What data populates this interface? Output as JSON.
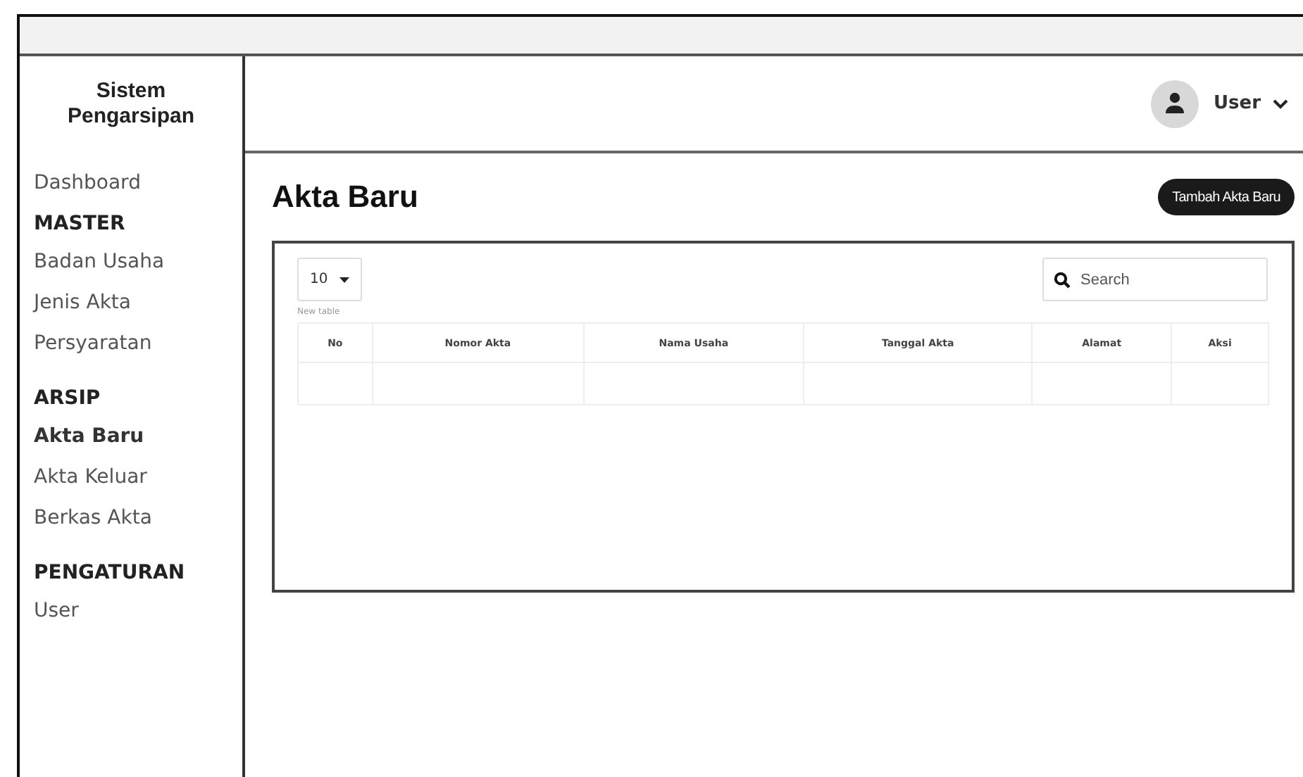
{
  "sidebar": {
    "brand": "Sistem Pengarsipan",
    "items": [
      {
        "kind": "link",
        "label": "Dashboard",
        "selected": false
      },
      {
        "kind": "heading",
        "label": "MASTER"
      },
      {
        "kind": "link",
        "label": "Badan Usaha",
        "selected": false
      },
      {
        "kind": "link",
        "label": "Jenis Akta",
        "selected": false
      },
      {
        "kind": "link",
        "label": "Persyaratan",
        "selected": false
      },
      {
        "kind": "heading",
        "label": "ARSIP"
      },
      {
        "kind": "link",
        "label": "Akta Baru",
        "selected": true
      },
      {
        "kind": "link",
        "label": "Akta Keluar",
        "selected": false
      },
      {
        "kind": "link",
        "label": "Berkas Akta",
        "selected": false
      },
      {
        "kind": "heading",
        "label": "PENGATURAN"
      },
      {
        "kind": "link",
        "label": "User",
        "selected": false
      }
    ]
  },
  "header": {
    "user": "User"
  },
  "page": {
    "title": "Akta Baru",
    "add_button": "Tambah Akta Baru"
  },
  "table": {
    "page_size": "10",
    "caption": "New table",
    "search": {
      "placeholder": "Search"
    },
    "columns": [
      "No",
      "Nomor Akta",
      "Nama Usaha",
      "Tanggal Akta",
      "Alamat",
      "Aksi"
    ]
  }
}
